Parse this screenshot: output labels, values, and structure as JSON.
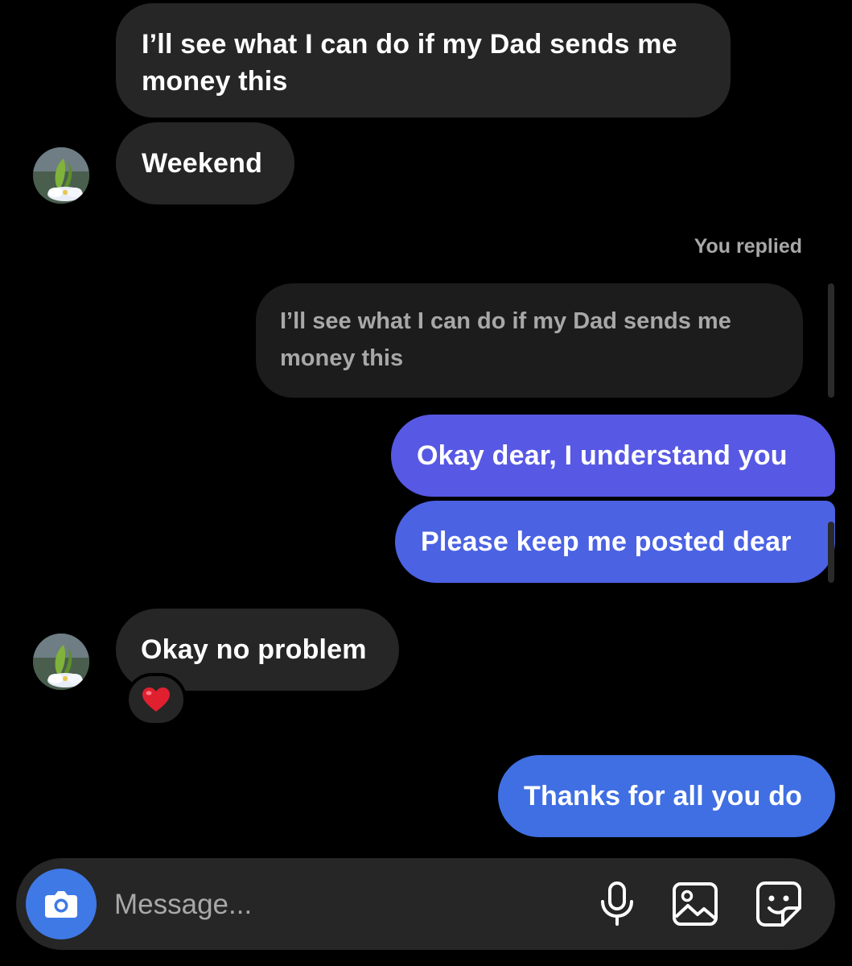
{
  "thread": {
    "messages": [
      {
        "sender": "contact",
        "text": "I’ll see what I can do if my Dad sends me money this"
      },
      {
        "sender": "contact",
        "text": "Weekend"
      },
      {
        "sender": "me",
        "reply_label": "You replied",
        "quoted_text": "I’ll see what I can do if my Dad sends me money this"
      },
      {
        "sender": "me",
        "text": "Okay dear, I understand  you"
      },
      {
        "sender": "me",
        "text": "Please keep me posted dear"
      },
      {
        "sender": "contact",
        "text": "Okay no problem",
        "reaction": "❤️"
      },
      {
        "sender": "me",
        "text": "Thanks for all you do"
      }
    ]
  },
  "composer": {
    "placeholder": "Message...",
    "icons": [
      "camera-icon",
      "microphone-icon",
      "gallery-icon",
      "sticker-icon"
    ]
  },
  "colors": {
    "background": "#000000",
    "incoming_bubble": "#262626",
    "quoted_bubble": "#1c1c1c",
    "outgoing_gradient_top": "#5a57e6",
    "outgoing_gradient_bottom": "#3f6fe2",
    "camera_button": "#3f79e6",
    "secondary_text": "#a8a8a8"
  }
}
